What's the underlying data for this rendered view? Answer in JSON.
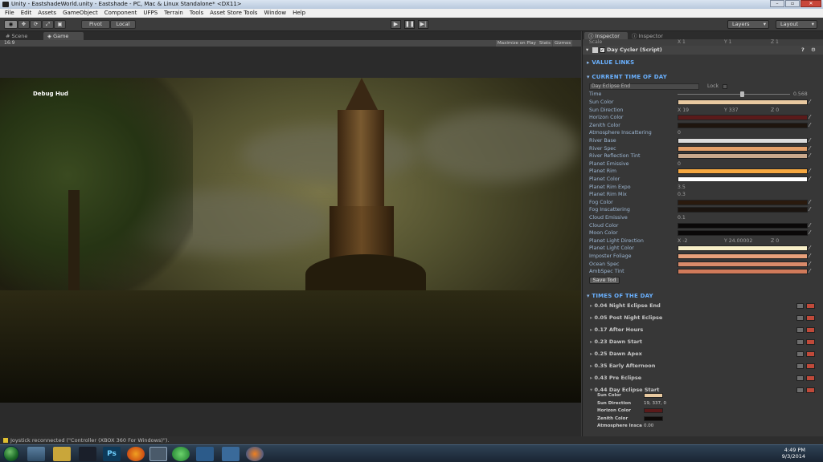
{
  "window": {
    "title": "Unity - EastshadeWorld.unity - Eastshade - PC, Mac & Linux Standalone* <DX11>"
  },
  "menu": [
    "File",
    "Edit",
    "Assets",
    "GameObject",
    "Component",
    "UFPS",
    "Terrain",
    "Tools",
    "Asset Store Tools",
    "Window",
    "Help"
  ],
  "toolbar": {
    "pivot": "Pivot",
    "local": "Local",
    "layers": "Layers",
    "layout": "Layout"
  },
  "tabs": {
    "scene": "Scene",
    "game": "Game"
  },
  "game_toolbar": {
    "aspect": "16:9",
    "maximize": "Maximize on Play",
    "stats": "Stats",
    "gizmos": "Gizmos"
  },
  "hud": {
    "debug": "Debug Hud"
  },
  "console": {
    "message": "Joystick reconnected (\"Controller (XBOX 360 For Windows)\")."
  },
  "inspector": {
    "tab1": "Inspector",
    "tab2": "Inspector",
    "scale_label": "Scale",
    "scale_x": "X 1",
    "scale_y": "Y 1",
    "scale_z": "Z 1",
    "component": "Day Cycler (Script)",
    "sections": {
      "value_links": "VALUE LINKS",
      "current": "CURRENT TIME OF DAY",
      "times": "TIMES OF THE DAY"
    },
    "preset_field": "Day Eclipse End",
    "lock_label": "Lock",
    "time_label": "Time",
    "time_value": "0.568",
    "save_button": "Save Tod",
    "props": [
      {
        "label": "Sun Color",
        "kind": "color",
        "color": "#e8c9a0"
      },
      {
        "label": "Sun Direction",
        "kind": "vec",
        "x": "X 19",
        "y": "Y 337",
        "z": "Z 0"
      },
      {
        "label": "Horizon Color",
        "kind": "color",
        "color": "#5a1a1a"
      },
      {
        "label": "Zenith Color",
        "kind": "color",
        "color": "#1e150e"
      },
      {
        "label": "Atmosphere Inscattering",
        "kind": "num",
        "value": "0"
      },
      {
        "label": "River Base",
        "kind": "color",
        "color": "#dcdcdc"
      },
      {
        "label": "River Spec",
        "kind": "color",
        "color": "#e3a06a"
      },
      {
        "label": "River Reflection Tint",
        "kind": "color",
        "color": "#caa98c"
      },
      {
        "label": "Planet Emissive",
        "kind": "num",
        "value": "0"
      },
      {
        "label": "Planet Rim",
        "kind": "color",
        "color": "#f6a840"
      },
      {
        "label": "Planet Color",
        "kind": "color",
        "color": "#ffffff"
      },
      {
        "label": "Planet Rim Expo",
        "kind": "num",
        "value": "3.5"
      },
      {
        "label": "Planet Rim Mix",
        "kind": "num",
        "value": "0.3"
      },
      {
        "label": "Fog Color",
        "kind": "color",
        "color": "#2a1a0e"
      },
      {
        "label": "Fog Inscattering",
        "kind": "color",
        "color": "#1a1410"
      },
      {
        "label": "Cloud Emissive",
        "kind": "num",
        "value": "0.1"
      },
      {
        "label": "Cloud Color",
        "kind": "color",
        "color": "#0a0808"
      },
      {
        "label": "Moon Color",
        "kind": "color",
        "color": "#0a0808"
      },
      {
        "label": "Planet Light Direction",
        "kind": "vec",
        "x": "X -2",
        "y": "Y 24.00002",
        "z": "Z 0"
      },
      {
        "label": "Planet Light Color",
        "kind": "color",
        "color": "#f8efc8"
      },
      {
        "label": "Imposter Foliage",
        "kind": "color",
        "color": "#e8a07a"
      },
      {
        "label": "Ocean Spec",
        "kind": "color",
        "color": "#d88a6a"
      },
      {
        "label": "AmbSpec Tint",
        "kind": "color",
        "color": "#d07a5a"
      }
    ],
    "times": [
      "0.04 Night Eclipse End",
      "0.05 Post Night Eclipse",
      "0.17 After Hours",
      "0.23 Dawn Start",
      "0.25 Dawn Apex",
      "0.35 Early Afternoon",
      "0.43 Pre Eclipse",
      "0.44 Day Eclipse Start"
    ],
    "expanded": [
      {
        "label": "Sun Color",
        "kind": "color",
        "color": "#e8c9a0"
      },
      {
        "label": "Sun Direction",
        "kind": "text",
        "value": "19, 337, 0"
      },
      {
        "label": "Horizon Color",
        "kind": "color",
        "color": "#5a1a1a"
      },
      {
        "label": "Zenith Color",
        "kind": "color",
        "color": "#0e0a08"
      },
      {
        "label": "Atmosphere Insca",
        "kind": "text",
        "value": "0.00"
      }
    ]
  },
  "clock": {
    "time": "4:49 PM",
    "date": "9/3/2014"
  }
}
